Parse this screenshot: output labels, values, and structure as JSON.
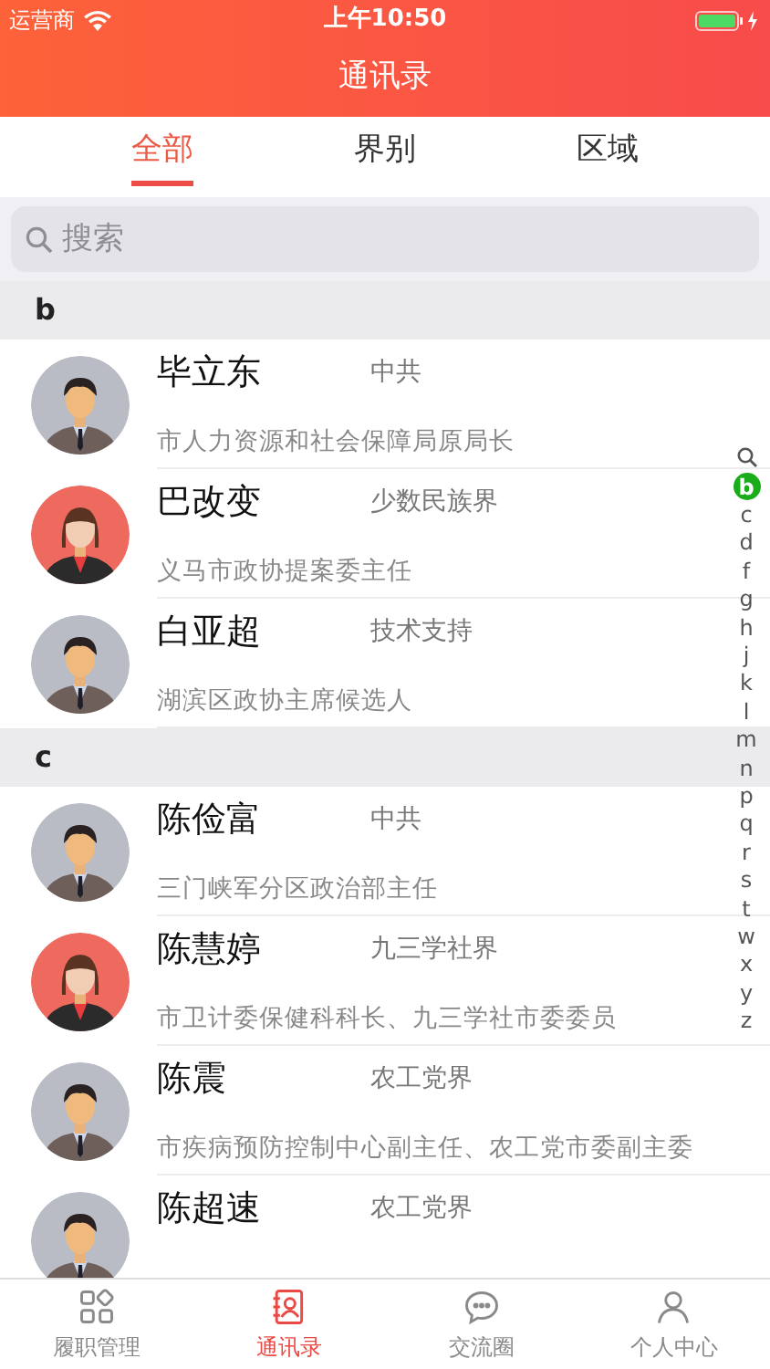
{
  "status_bar": {
    "carrier": "运营商",
    "time": "上午10:50"
  },
  "nav": {
    "title": "通讯录"
  },
  "tabs": [
    {
      "label": "全部",
      "selected": true
    },
    {
      "label": "界别",
      "selected": false
    },
    {
      "label": "区域",
      "selected": false
    }
  ],
  "search": {
    "placeholder": "搜索"
  },
  "sections": [
    {
      "letter": "b",
      "contacts": [
        {
          "name": "毕立东",
          "group": "中共",
          "title": "市人力资源和社会保障局原局长",
          "kind": "male"
        },
        {
          "name": "巴改变",
          "group": "少数民族界",
          "title": "义马市政协提案委主任",
          "kind": "female"
        },
        {
          "name": "白亚超",
          "group": "技术支持",
          "title": "湖滨区政协主席候选人",
          "kind": "male"
        }
      ]
    },
    {
      "letter": "c",
      "contacts": [
        {
          "name": "陈俭富",
          "group": "中共",
          "title": "三门峡军分区政治部主任",
          "kind": "male"
        },
        {
          "name": "陈慧婷",
          "group": "九三学社界",
          "title": "市卫计委保健科科长、九三学社市委委员",
          "kind": "female"
        },
        {
          "name": "陈震",
          "group": "农工党界",
          "title": "市疾病预防控制中心副主任、农工党市委副主委",
          "kind": "male"
        },
        {
          "name": "陈超速",
          "group": "农工党界",
          "kind": "male"
        }
      ]
    }
  ],
  "index": [
    {
      "letter": "b",
      "selected": true
    },
    {
      "letter": "c",
      "selected": false
    },
    {
      "letter": "d",
      "selected": false
    },
    {
      "letter": "f",
      "selected": false
    },
    {
      "letter": "g",
      "selected": false
    },
    {
      "letter": "h",
      "selected": false
    },
    {
      "letter": "j",
      "selected": false
    },
    {
      "letter": "k",
      "selected": false
    },
    {
      "letter": "l",
      "selected": false
    },
    {
      "letter": "m",
      "selected": false
    },
    {
      "letter": "n",
      "selected": false
    },
    {
      "letter": "p",
      "selected": false
    },
    {
      "letter": "q",
      "selected": false
    },
    {
      "letter": "r",
      "selected": false
    },
    {
      "letter": "s",
      "selected": false
    },
    {
      "letter": "t",
      "selected": false
    },
    {
      "letter": "w",
      "selected": false
    },
    {
      "letter": "x",
      "selected": false
    },
    {
      "letter": "y",
      "selected": false
    },
    {
      "letter": "z",
      "selected": false
    }
  ],
  "tab_bar": [
    {
      "label": "履职管理",
      "kind": "grid",
      "selected": false
    },
    {
      "label": "通讯录",
      "kind": "contacts",
      "selected": true
    },
    {
      "label": "交流圈",
      "kind": "chat",
      "selected": false
    },
    {
      "label": "个人中心",
      "kind": "person",
      "selected": false
    }
  ]
}
